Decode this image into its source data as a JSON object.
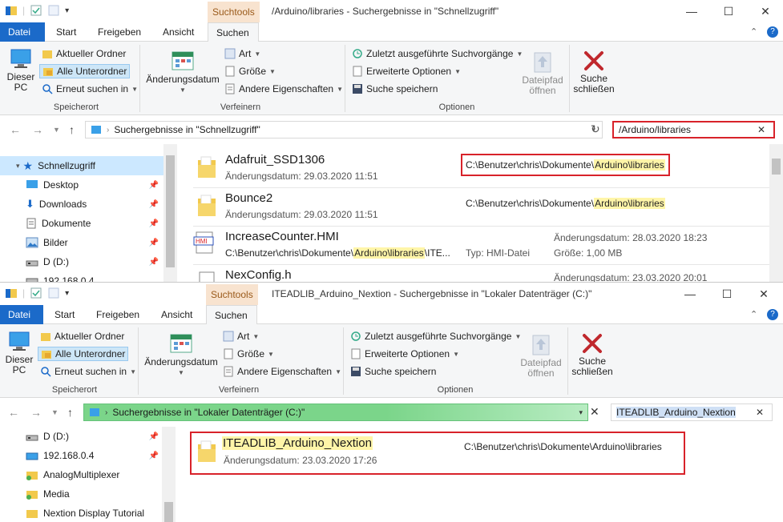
{
  "colors": {
    "accent": "#1b6ac9",
    "highlight": "#fff5a8",
    "red": "#d8222a",
    "green": "#7bd58a",
    "context_tab": "#f8e3cf"
  },
  "window1": {
    "context_tab": "Suchtools",
    "title": "/Arduino/libraries - Suchergebnisse in \"Schnellzugriff\"",
    "tabs": [
      "Datei",
      "Start",
      "Freigeben",
      "Ansicht",
      "Suchen"
    ],
    "ribbon": {
      "this_pc": "Dieser PC",
      "current_folder": "Aktueller Ordner",
      "all_subfolders": "Alle Unterordner",
      "search_again": "Erneut suchen in",
      "group_location": "Speicherort",
      "change_date": "Änderungsdatum",
      "type": "Art",
      "size": "Größe",
      "other_props": "Andere Eigenschaften",
      "group_refine": "Verfeinern",
      "recent_searches": "Zuletzt ausgeführte Suchvorgänge",
      "advanced_options": "Erweiterte Optionen",
      "save_search": "Suche speichern",
      "open_path": "Dateipfad öffnen",
      "close_search": "Suche schließen",
      "group_options": "Optionen"
    },
    "address": "Suchergebnisse in \"Schnellzugriff\"",
    "search_value": "/Arduino/libraries",
    "nav": [
      {
        "label": "Schnellzugriff",
        "icon": "star-icon"
      },
      {
        "label": "Desktop",
        "icon": "desktop-icon"
      },
      {
        "label": "Downloads",
        "icon": "download-icon"
      },
      {
        "label": "Dokumente",
        "icon": "document-icon"
      },
      {
        "label": "Bilder",
        "icon": "image-icon"
      },
      {
        "label": "D (D:)",
        "icon": "drive-icon"
      },
      {
        "label": "192.168.0.4",
        "icon": "network-drive-icon"
      }
    ],
    "results": [
      {
        "name": "Adafruit_SSD1306",
        "meta": "Änderungsdatum: 29.03.2020 11:51",
        "path_prefix": "C:\\Benutzer\\chris\\Dokumente\\",
        "path_hl": "Arduino\\libraries",
        "icon": "folder-icon"
      },
      {
        "name": "Bounce2",
        "meta": "Änderungsdatum: 29.03.2020 11:51",
        "path_prefix": "C:\\Benutzer\\chris\\Dokumente\\",
        "path_hl": "Arduino\\libraries",
        "icon": "folder-icon"
      },
      {
        "name": "IncreaseCounter.HMI",
        "meta_prefix": "C:\\Benutzer\\chris\\Dokumente\\",
        "meta_hl": "Arduino\\libraries",
        "meta_suffix": "\\ITE...",
        "type_label": "Typ: HMI-Datei",
        "date_label": "Änderungsdatum: 28.03.2020 18:23",
        "size_label": "Größe: 1,00 MB",
        "icon": "hmi-file-icon"
      },
      {
        "name": "NexConfig.h",
        "date_label": "Änderungsdatum: 23.03.2020 20:01",
        "icon": "file-icon"
      }
    ]
  },
  "window2": {
    "context_tab": "Suchtools",
    "title": "ITEADLIB_Arduino_Nextion - Suchergebnisse in \"Lokaler Datenträger (C:)\"",
    "address": "Suchergebnisse in \"Lokaler Datenträger (C:)\"",
    "search_value": "ITEADLIB_Arduino_Nextion",
    "nav": [
      {
        "label": "D (D:)",
        "icon": "drive-icon"
      },
      {
        "label": "192.168.0.4",
        "icon": "network-drive-icon"
      },
      {
        "label": "AnalogMultiplexer",
        "icon": "folder-icon"
      },
      {
        "label": "Media",
        "icon": "folder-icon"
      },
      {
        "label": "Nextion Display Tutorial",
        "icon": "folder-icon"
      }
    ],
    "result": {
      "name": "ITEADLIB_Arduino_Nextion",
      "meta": "Änderungsdatum: 23.03.2020 17:26",
      "path": "C:\\Benutzer\\chris\\Dokumente\\Arduino\\libraries"
    }
  }
}
